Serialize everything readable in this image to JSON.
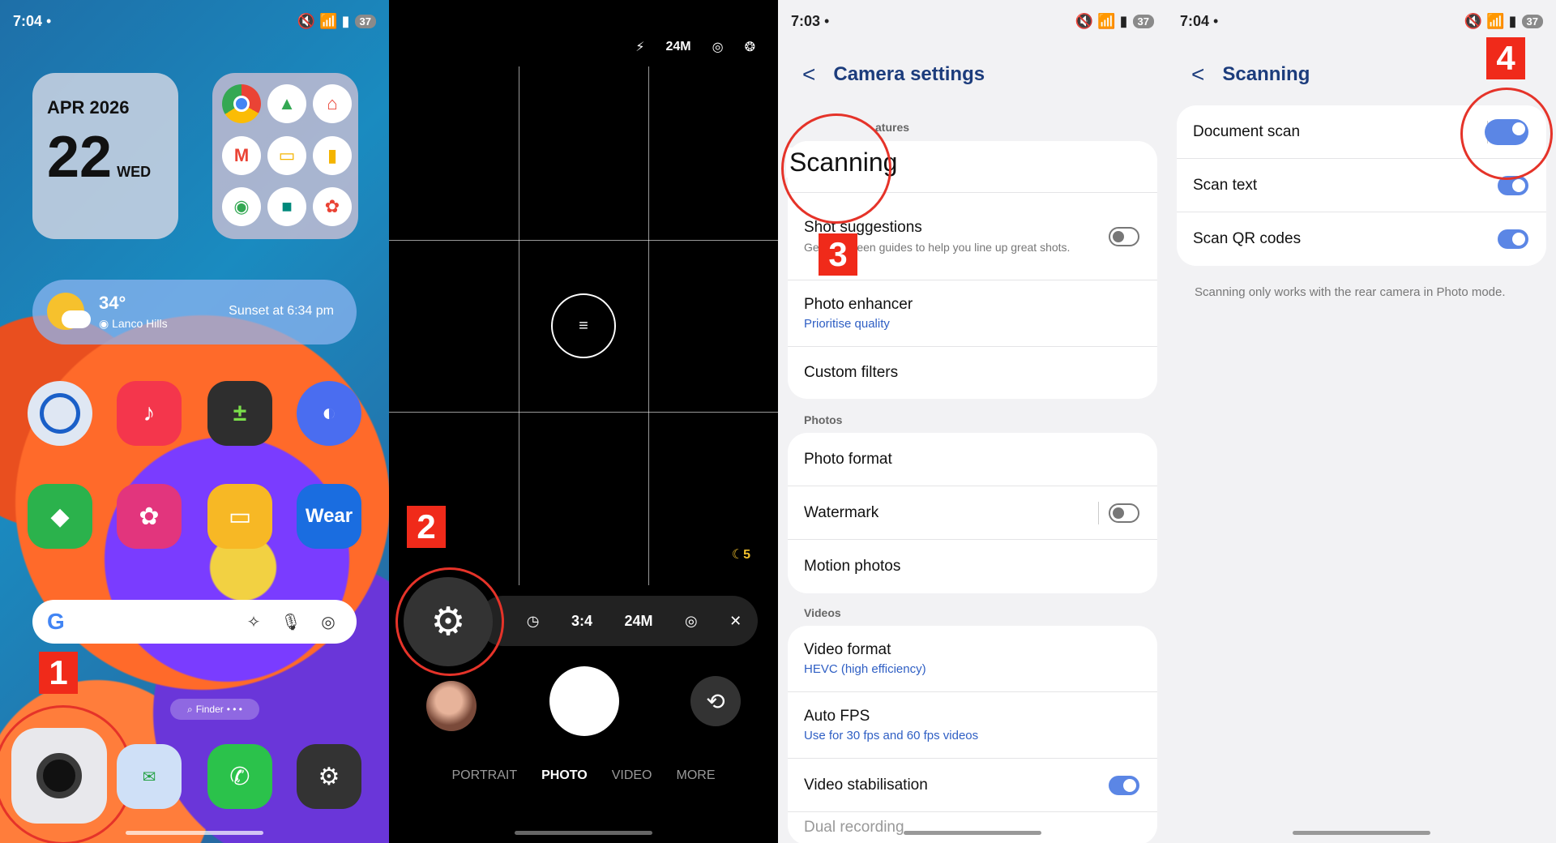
{
  "panel1": {
    "status_time": "7:04",
    "status_dot": "•",
    "status_icons": "🔇 📶 ▮",
    "battery": "37",
    "date_month": "APR 2026",
    "date_day": "22",
    "date_dow": "WED",
    "folder_apps": [
      "chrome-icon",
      "drive-icon",
      "home-icon",
      "gmail-icon",
      "slides-icon",
      "keep-icon",
      "maps-icon",
      "meet-icon",
      "photos-icon"
    ],
    "weather_temp": "34°",
    "weather_location": "Lanco Hills",
    "weather_sunset": "Sunset at 6:34 pm",
    "app_wear_label": "Wear",
    "search_g": "G",
    "pager_label": "Finder",
    "step": "1"
  },
  "panel2": {
    "top_flash": "⚡",
    "top_res": "24M",
    "toolbar": {
      "timer": "◷",
      "ratio": "3:4",
      "res": "24M",
      "close": "✕"
    },
    "night_count": "5",
    "settings_icon": "⚙",
    "flip_icon": "⟲",
    "modes": [
      "PORTRAIT",
      "PHOTO",
      "VIDEO",
      "MORE"
    ],
    "step": "2"
  },
  "panel3": {
    "status_time": "7:03",
    "status_dot": "•",
    "status_icons": "🔇 📶 ▮",
    "battery": "37",
    "back": "<",
    "title": "Camera settings",
    "section_features": "atures",
    "scanning_label": "Scanning",
    "shot_suggestions": "Shot suggestions",
    "shot_desc": "Get on-screen guides to help you line up great shots.",
    "photo_enhancer": "Photo enhancer",
    "photo_enhancer_sub": "Prioritise quality",
    "custom_filters": "Custom filters",
    "section_photos": "Photos",
    "photo_format": "Photo format",
    "watermark": "Watermark",
    "motion_photos": "Motion photos",
    "section_videos": "Videos",
    "video_format": "Video format",
    "video_format_sub": "HEVC (high efficiency)",
    "auto_fps": "Auto FPS",
    "auto_fps_sub": "Use for 30 fps and 60 fps videos",
    "video_stab": "Video stabilisation",
    "dual_recording": "Dual recording",
    "step": "3"
  },
  "panel4": {
    "status_time": "7:04",
    "status_dot": "•",
    "status_icons": "🔇 📶 ▮",
    "battery": "37",
    "back": "<",
    "title": "Scanning",
    "document_scan": "Document scan",
    "scan_text": "Scan text",
    "scan_qr": "Scan QR codes",
    "note": "Scanning only works with the rear camera in Photo mode.",
    "step": "4"
  },
  "colors": {
    "accent": "#5b86e5",
    "highlight": "#e53329",
    "title": "#1c3c7c"
  }
}
